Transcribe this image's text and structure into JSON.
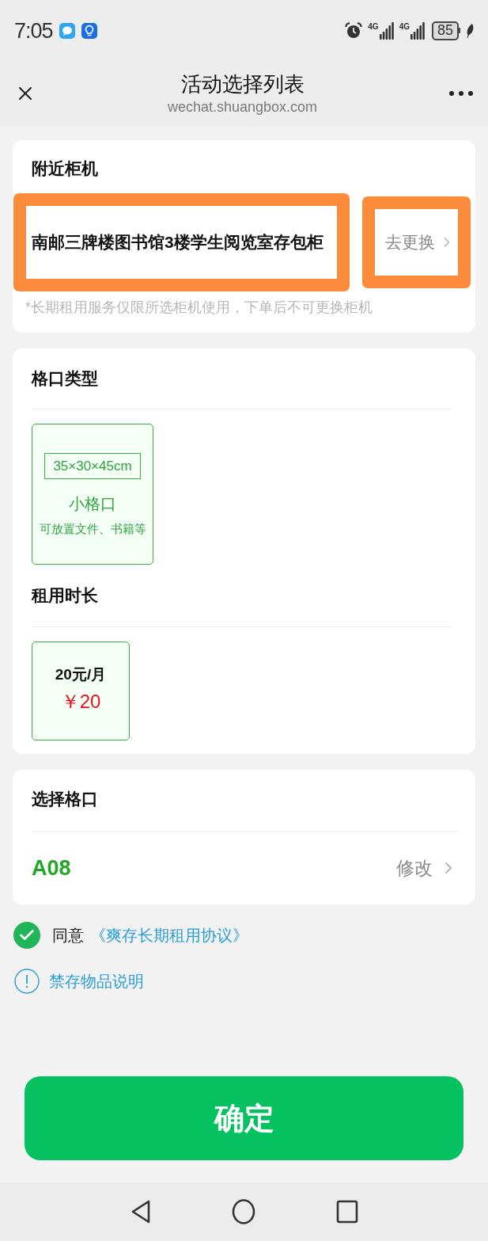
{
  "status_bar": {
    "time": "7:05",
    "signals": [
      {
        "label": "4G"
      },
      {
        "label": "4G"
      }
    ],
    "battery": "85"
  },
  "header": {
    "title": "活动选择列表",
    "subtitle": "wechat.shuangbox.com"
  },
  "locker_card": {
    "title": "附近柜机",
    "locker": {
      "name": "南邮三牌楼图书馆3楼学生阅览室存包柜",
      "highlighted": true
    },
    "change": {
      "label": "去更换",
      "highlighted": true
    },
    "note": "*长期租用服务仅限所选柜机使用，下单后不可更换柜机"
  },
  "compartment_card": {
    "title": "格口类型",
    "types": [
      {
        "size": "35×30×45cm",
        "name": "小格口",
        "description": "可放置文件、书籍等",
        "selected": true
      }
    ],
    "duration_title": "租用时长",
    "plans": [
      {
        "label": "20元/月",
        "price": "￥20",
        "selected": true
      }
    ]
  },
  "slot_card": {
    "title": "选择格口",
    "slot": "A08",
    "edit_label": "修改"
  },
  "agreement": {
    "checked": true,
    "prefix": "同意",
    "link": "《爽存长期租用协议》"
  },
  "prohibited_link": "禁存物品说明",
  "confirm_button": "确定"
}
